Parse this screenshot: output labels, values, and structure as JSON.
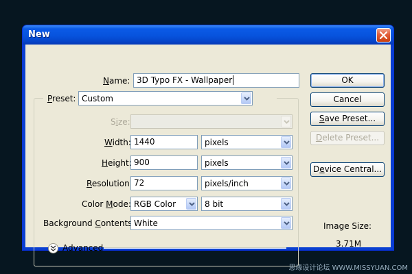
{
  "window": {
    "title": "New"
  },
  "fields": {
    "name_label_ul": "N",
    "name_label_rest": "ame:",
    "name_value": "3D Typo FX - Wallpaper",
    "preset_label_ul": "P",
    "preset_label_rest": "reset:",
    "preset_value": "Custom",
    "size_label_pre": "S",
    "size_label_ul": "i",
    "size_label_rest": "ze:",
    "size_value": "",
    "width_label_ul": "W",
    "width_label_rest": "idth:",
    "width_value": "1440",
    "width_unit": "pixels",
    "height_label_ul": "H",
    "height_label_rest": "eight:",
    "height_value": "900",
    "height_unit": "pixels",
    "resolution_label_ul": "R",
    "resolution_label_rest": "esolution:",
    "resolution_value": "72",
    "resolution_unit": "pixels/inch",
    "colormode_label_pre": "Color ",
    "colormode_label_ul": "M",
    "colormode_label_rest": "ode:",
    "colormode_value": "RGB Color",
    "bitdepth_value": "8 bit",
    "bg_label_pre": "Background ",
    "bg_label_ul": "C",
    "bg_label_rest": "ontents:",
    "bg_value": "White",
    "advanced_label": "Advanced"
  },
  "buttons": {
    "ok": "OK",
    "cancel": "Cancel",
    "save_ul": "S",
    "save_rest": "ave Preset...",
    "delete_ul": "D",
    "delete_rest": "elete Preset...",
    "device_pre": "D",
    "device_ul": "e",
    "device_rest": "vice Central..."
  },
  "image_size": {
    "label": "Image Size:",
    "value": "3.71M"
  },
  "watermark": "思缘设计论坛 WWW.MISSYUAN.COM",
  "colors": {
    "titlebar": "#0753dd",
    "client": "#ece9d8",
    "close": "#e35e3a"
  },
  "icons": [
    "close-icon",
    "chevron-down-icon",
    "double-chevron-down-icon"
  ]
}
